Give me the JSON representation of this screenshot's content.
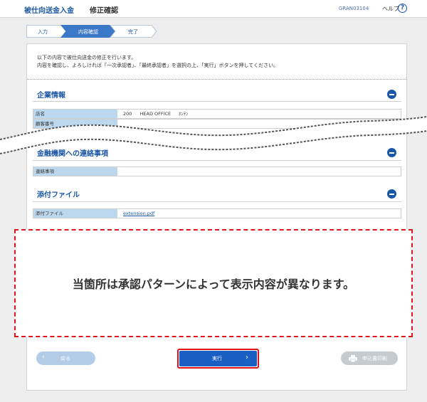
{
  "header": {
    "title": "被仕向送金入金",
    "subtitle": "修正確認",
    "screen_id": "GRAN03104",
    "help_label": "ヘルプ",
    "help_icon": "?"
  },
  "steps": [
    {
      "label": "入力",
      "state": "done"
    },
    {
      "label": "内容確認",
      "state": "active"
    },
    {
      "label": "完了",
      "state": "todo"
    }
  ],
  "intro": {
    "line1": "以下の内容で被仕向送金の修正を行います。",
    "line2": "内容を確認し、よろしければ「一次承認者」、「最終承認者」を選択の上、「実行」ボタンを押してください。"
  },
  "sections": {
    "company": {
      "title": "企業情報",
      "rows": [
        {
          "label": "店名",
          "values": [
            "200",
            "HEAD OFFICE",
            "ﾎﾝﾃﾝ"
          ]
        },
        {
          "label": "顧客番号"
        }
      ]
    },
    "bank_notes": {
      "title": "金融機関への連絡事項",
      "rows": [
        {
          "label": "連絡事項",
          "value": ""
        }
      ]
    },
    "attachments": {
      "title": "添付ファイル",
      "rows": [
        {
          "label": "添付ファイル",
          "value": "extension.pdf"
        }
      ]
    }
  },
  "notice": {
    "text": "当箇所は承認パターンによって表示内容が異なります。"
  },
  "buttons": {
    "back": "戻る",
    "execute": "実行",
    "print": "申込書印刷"
  },
  "colors": {
    "brand_blue": "#1a56a6",
    "label_bg": "#bcd8ee",
    "highlight_red": "#e0141c",
    "execute_bg": "#1a5fc4"
  }
}
